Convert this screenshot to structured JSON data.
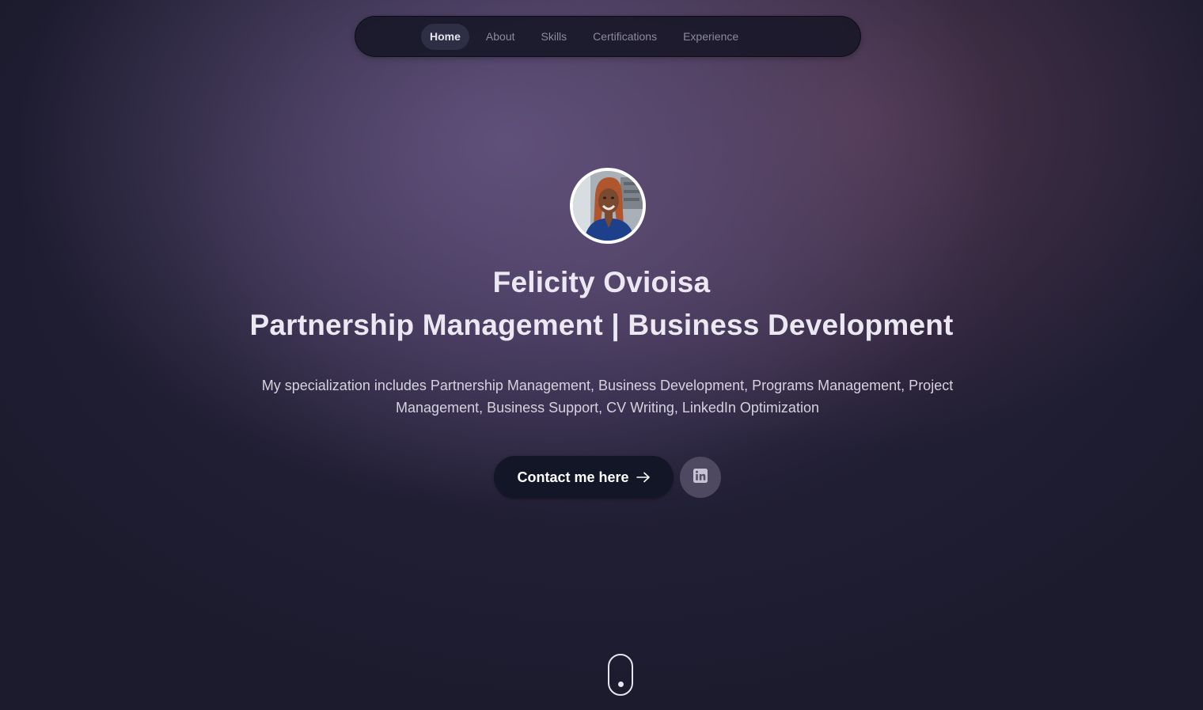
{
  "nav": {
    "items": [
      {
        "label": "Home",
        "active": true
      },
      {
        "label": "About",
        "active": false
      },
      {
        "label": "Skills",
        "active": false
      },
      {
        "label": "Certifications",
        "active": false
      },
      {
        "label": "Experience",
        "active": false
      }
    ]
  },
  "hero": {
    "name": "Felicity Ovioisa",
    "tagline": "Partnership Management | Business Development",
    "bio": "My specialization includes Partnership Management, Business Development, Programs Management, Project Management, Business Support, CV Writing, LinkedIn Optimization",
    "cta_label": "Contact me here",
    "cta_icon": "arrow-right-icon",
    "social_icon": "linkedin-icon",
    "avatar_alt": "profile photo"
  },
  "colors": {
    "background": "#1c1b2e",
    "nav_bg": "#161626",
    "cta_bg": "#121626",
    "text": "#ece8f2"
  }
}
